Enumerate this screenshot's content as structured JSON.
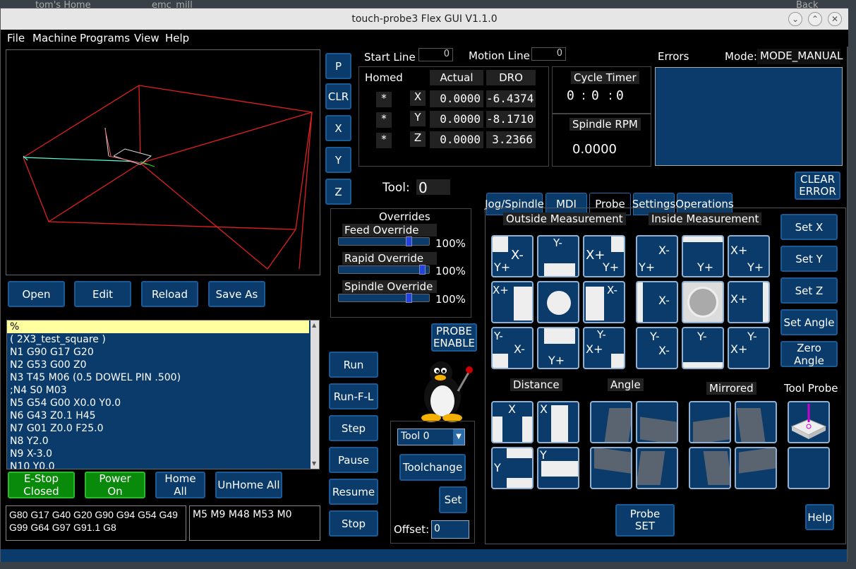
{
  "background": {
    "tab1": "tom's Home",
    "tab2": "emc_mill",
    "back": "Back"
  },
  "window": {
    "title": "touch-probe3 Flex GUI V1.1.0"
  },
  "menu": [
    "File",
    "Machine",
    "Programs",
    "View",
    "Help"
  ],
  "left_buttons": [
    "P",
    "CLR",
    "X",
    "Y",
    "Z"
  ],
  "file_buttons": {
    "open": "Open",
    "edit": "Edit",
    "reload": "Reload",
    "save_as": "Save As"
  },
  "gcode_lines": [
    "%",
    "( 2X3_test_square )",
    "N1 G90 G17 G20",
    "N2 G53 G00 Z0",
    "N3 T45 M06 (0.5 DOWEL PIN .500)",
    ";N4 S0 M03",
    "N5 G54 G00 X0.0 Y0.0",
    "N6 G43 Z0.1 H45",
    "N7 G01 Z0.0 F25.0",
    "N8 Y2.0",
    "N9 X-3.0",
    "N10 Y0.0"
  ],
  "machine_buttons": {
    "estop": "E-Stop Closed",
    "estop_1": "E-Stop",
    "estop_2": "Closed",
    "power_1": "Power",
    "power_2": "On",
    "home_all": "Home All",
    "unhome_all": "UnHome All"
  },
  "gcodes_active": "G80 G17 G40 G20 G90 G94 G54 G49 G99 G64 G97 G91.1 G8",
  "mcodes_active": "M5 M9 M48 M53 M0",
  "start_line": {
    "label": "Start Line",
    "value": "0"
  },
  "motion_line": {
    "label": "Motion Line",
    "value": "0"
  },
  "dro": {
    "headers": {
      "homed": "Homed",
      "actual": "Actual",
      "dro": "DRO"
    },
    "rows": [
      {
        "homed": "*",
        "axis": "X",
        "actual": "0.0000",
        "dro": "-6.4374"
      },
      {
        "homed": "*",
        "axis": "Y",
        "actual": "0.0000",
        "dro": "-8.1710"
      },
      {
        "homed": "*",
        "axis": "Z",
        "actual": "0.0000",
        "dro": "3.2366"
      }
    ]
  },
  "cycle_timer": {
    "label": "Cycle Timer",
    "h": "0",
    "m": "0",
    "s": "0"
  },
  "spindle_rpm": {
    "label": "Spindle RPM",
    "value": "0.0000"
  },
  "errors": {
    "label": "Errors",
    "mode_label": "Mode:",
    "mode": "MODE_MANUAL",
    "clear": "CLEAR ERROR",
    "clear_1": "CLEAR",
    "clear_2": "ERROR"
  },
  "tool": {
    "label": "Tool:",
    "value": "0"
  },
  "overrides": {
    "title": "Overrides",
    "items": [
      {
        "label": "Feed Override",
        "value": "100%",
        "level": 1.0
      },
      {
        "label": "Rapid Override",
        "value": "100%",
        "level": 1.0
      },
      {
        "label": "Spindle Override",
        "value": "100%",
        "level": 1.0
      }
    ]
  },
  "run_buttons": [
    "Run",
    "Run-F-L",
    "Step",
    "Pause",
    "Resume",
    "Stop"
  ],
  "probe_enable": {
    "line1": "PROBE",
    "line2": "ENABLE"
  },
  "toolchange": {
    "select": "Tool 0",
    "toolchange": "Toolchange",
    "set": "Set",
    "offset_label": "Offset:",
    "offset_value": "0"
  },
  "tabs": [
    "Jog/Spindle",
    "MDI",
    "Probe",
    "Settings",
    "Operations"
  ],
  "probe": {
    "outside": "Outside Measurement",
    "inside": "Inside Measurement",
    "set_buttons": [
      "Set X",
      "Set Y",
      "Set Z",
      "Set Angle",
      "Zero Angle"
    ],
    "distance": "Distance",
    "angle": "Angle",
    "mirrored": "Mirrored",
    "tool_probe": "Tool Probe",
    "probe_set_1": "Probe",
    "probe_set_2": "SET",
    "help": "Help",
    "outside_labels": [
      "X-",
      "Y+",
      "Y-",
      "X+",
      "Y+",
      "X+",
      "X-",
      "Y-",
      "X-",
      "Y+",
      "Y-",
      "X+",
      "Y+"
    ],
    "inside_labels": [
      "X-",
      "Y+",
      "Y+",
      "X+",
      "Y+",
      "X-",
      "X+",
      "Y-",
      "X-",
      "Y-",
      "Y-",
      "X+"
    ],
    "distance_labels": [
      "X",
      "X",
      "Y",
      "Y"
    ]
  }
}
